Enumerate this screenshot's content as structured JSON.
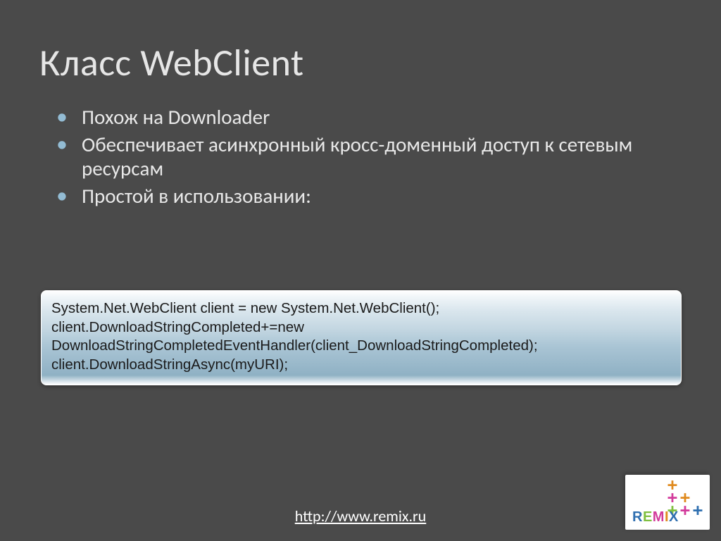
{
  "title": "Класс WebClient",
  "bullets": [
    "Похож на Downloader",
    "Обеспечивает асинхронный кросс-доменный доступ к сетевым ресурсам",
    "Простой в использовании:"
  ],
  "code": {
    "line1": "System.Net.WebClient client = new System.Net.WebClient();",
    "line2": "client.DownloadStringCompleted+=new DownloadStringCompletedEventHandler(client_DownloadStringCompleted);",
    "line3": "client.DownloadStringAsync(myURI);"
  },
  "footer_url": "http://www.remix.ru",
  "brand": {
    "word": "REMIX",
    "colors": {
      "col1": "#7fbf3f",
      "col2": "#d23a9b",
      "col3": "#e08a1e",
      "R": "#2f6fb0",
      "E": "#7fbf3f",
      "M": "#d23a9b",
      "I": "#e08a1e",
      "X": "#2f6fb0"
    }
  }
}
